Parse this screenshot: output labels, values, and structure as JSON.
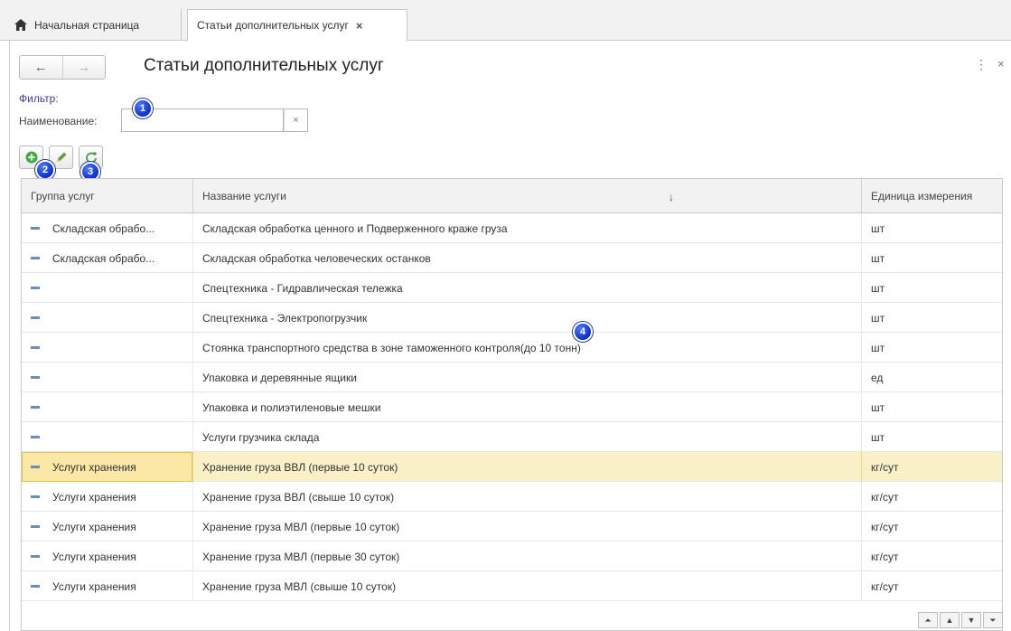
{
  "tabs": {
    "home_label": "Начальная страница",
    "active_label": "Статьи дополнительных услуг",
    "close_glyph": "×"
  },
  "form": {
    "back_glyph": "←",
    "forward_glyph": "→",
    "title": "Статьи дополнительных услуг",
    "more_glyph": "⋮",
    "close_glyph": "×",
    "filter_label": "Фильтр:",
    "name_label": "Наименование:",
    "name_value": "",
    "clear_glyph": "×"
  },
  "markers": [
    "1",
    "2",
    "3",
    "4"
  ],
  "icons": {
    "add": "add-icon",
    "edit": "pencil-icon",
    "refresh": "refresh-icon",
    "row": "dash-icon"
  },
  "colors": {
    "add_green": "#3fae3f",
    "selection": "#faf0c8",
    "marker_blue": "#0a2fc9"
  },
  "table": {
    "columns": [
      "Группа услуг",
      "Название услуги",
      "Единица измерения"
    ],
    "sort_glyph": "↓",
    "selected_row": 8,
    "rows": [
      {
        "group": "Складская обрабо...",
        "name": "Складская обработка ценного и Подверженного краже груза",
        "unit": "шт"
      },
      {
        "group": "Складская обрабо...",
        "name": "Складская обработка человеческих останков",
        "unit": "шт"
      },
      {
        "group": "",
        "name": "Спецтехника - Гидравлическая тележка",
        "unit": "шт"
      },
      {
        "group": "",
        "name": "Спецтехника - Электропогрузчик",
        "unit": "шт"
      },
      {
        "group": "",
        "name": "Стоянка транспортного средства в зоне таможенного контроля(до 10 тонн)",
        "unit": "шт"
      },
      {
        "group": "",
        "name": "Упаковка и деревянные ящики",
        "unit": "ед"
      },
      {
        "group": "",
        "name": "Упаковка и полиэтиленовые мешки",
        "unit": "шт"
      },
      {
        "group": "",
        "name": "Услуги грузчика склада",
        "unit": "шт"
      },
      {
        "group": "Услуги хранения",
        "name": "Хранение груза ВВЛ (первые 10 суток)",
        "unit": "кг/сут"
      },
      {
        "group": "Услуги хранения",
        "name": "Хранение груза ВВЛ (свыше 10 суток)",
        "unit": "кг/сут"
      },
      {
        "group": "Услуги хранения",
        "name": "Хранение груза МВЛ (первые 10 суток)",
        "unit": "кг/сут"
      },
      {
        "group": "Услуги хранения",
        "name": "Хранение груза МВЛ (первые 30 суток)",
        "unit": "кг/сут"
      },
      {
        "group": "Услуги хранения",
        "name": "Хранение груза МВЛ (свыше 10 суток)",
        "unit": "кг/сут"
      }
    ]
  },
  "scroll": {
    "first_glyph": "⏶",
    "up_glyph": "▲",
    "down_glyph": "▼",
    "last_glyph": "⏷"
  }
}
